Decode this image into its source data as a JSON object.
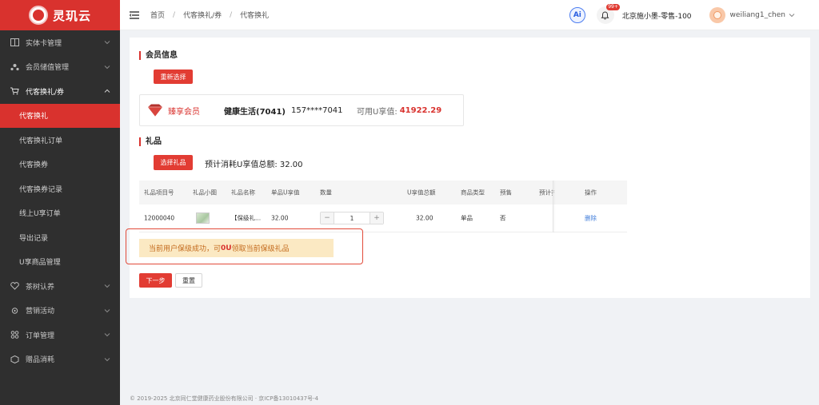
{
  "brand": {
    "name": "灵玑云"
  },
  "sidebar": {
    "items": [
      {
        "label": "实体卡管理",
        "icon": "book-icon",
        "type": "top",
        "expanded": false
      },
      {
        "label": "会员储值管理",
        "icon": "users-icon",
        "type": "top",
        "expanded": false
      },
      {
        "label": "代客换礼/券",
        "icon": "cart-icon",
        "type": "top",
        "expanded": true
      },
      {
        "label": "代客换礼",
        "type": "sub",
        "active": true
      },
      {
        "label": "代客换礼订单",
        "type": "sub"
      },
      {
        "label": "代客换券",
        "type": "sub"
      },
      {
        "label": "代客换券记录",
        "type": "sub"
      },
      {
        "label": "线上U享订单",
        "type": "sub"
      },
      {
        "label": "导出记录",
        "type": "sub"
      },
      {
        "label": "U享商品管理",
        "type": "sub"
      },
      {
        "label": "茶树认养",
        "icon": "heart-icon",
        "type": "top",
        "expanded": false
      },
      {
        "label": "营销活动",
        "icon": "gear-icon",
        "type": "top",
        "expanded": false
      },
      {
        "label": "订单管理",
        "icon": "grid-icon",
        "type": "top",
        "expanded": false
      },
      {
        "label": "赠品消耗",
        "icon": "box-icon",
        "type": "top",
        "expanded": false
      }
    ]
  },
  "header": {
    "breadcrumb": [
      "首页",
      "代客换礼/券",
      "代客换礼"
    ],
    "ai_label": "Ai",
    "notification_badge": "99+",
    "store_name": "北京施小墨-零售-100",
    "username": "weiliang1_chen"
  },
  "member": {
    "section_title": "会员信息",
    "reselect_label": "重新选择",
    "level": "臻享会员",
    "name": "健康生活(7041)",
    "phone": "157****7041",
    "u_label": "可用U享值:",
    "u_value": "41922.29"
  },
  "gifts": {
    "section_title": "礼品",
    "select_label": "选择礼品",
    "estimate": "预计消耗U享值总额: 32.00",
    "columns": [
      "礼品项目号",
      "礼品小图",
      "礼品名称",
      "单品U享值",
      "数量",
      "U享值总额",
      "商品类型",
      "预售",
      "预计扌",
      "操作"
    ],
    "rows": [
      {
        "code": "12000040",
        "name": "【保级礼...",
        "unit_value": "32.00",
        "qty_minus": "−",
        "quantity": "1",
        "qty_plus": "+",
        "total": "32.00",
        "type": "单品",
        "presale": "否",
        "estimate": "",
        "action": "删除"
      }
    ]
  },
  "notice": {
    "prefix": "当前用户保级成功，可",
    "highlight": "0U",
    "suffix": "领取当前保级礼品"
  },
  "actions": {
    "next_label": "下一步",
    "reset_label": "重置"
  },
  "footer": {
    "text": "© 2019-2025 北京同仁堂健康药业股份有限公司 · 京ICP备13010437号-4"
  },
  "colors": {
    "brand_red": "#d9322e",
    "sidebar_bg": "#2f2f2f",
    "notice_bg": "#fbe9c3",
    "link_blue": "#3d7bd9"
  }
}
